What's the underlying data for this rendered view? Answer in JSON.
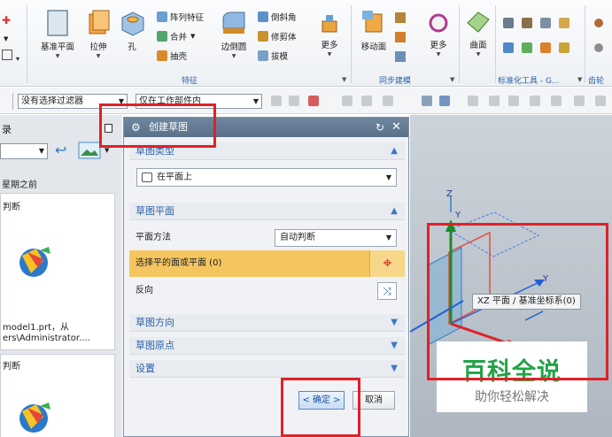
{
  "ribbon": {
    "feature_items": {
      "pattern": "阵列特征",
      "combine": "合并",
      "shell": "抽壳"
    },
    "buttons": {
      "datum_plane": "基准平面",
      "extrude": "拉伸",
      "hole": "孔",
      "edge_blend": "边倒圆",
      "more": "更多"
    },
    "direct_items": {
      "chamfer": "倒斜角",
      "trim_body": "修剪体",
      "draft": "拔模"
    },
    "sync": {
      "move_face": "移动面",
      "more": "更多"
    },
    "surface": "曲面",
    "groups": {
      "feature": "特征",
      "sync": "同步建模",
      "standard": "标准化工具 - G...",
      "gear": "齿轮"
    }
  },
  "filterbar": {
    "filter": "没有选择过滤器",
    "scope": "仅在工作部件内"
  },
  "navigator": {
    "title": "录",
    "group_before": "星期之前",
    "item_text1": "判断",
    "file_name": "model1.prt，从",
    "file_path": "ers\\Administrator....",
    "item_text2": "判断"
  },
  "dialog": {
    "title": "创建草图",
    "sketch_type_section": "草图类型",
    "sketch_type_value": "在平面上",
    "sketch_plane_section": "草图平面",
    "plane_method_label": "平面方法",
    "plane_method_value": "自动判断",
    "select_face_label": "选择平的面或平面 (0)",
    "reverse_label": "反向",
    "sketch_orientation_section": "草图方向",
    "sketch_origin_section": "草图原点",
    "settings_section": "设置",
    "ok_label": "< 确定 >",
    "cancel_label": "取消"
  },
  "viewport": {
    "axis_z": "Z",
    "axis_y": "Y",
    "axis_y2": "Y",
    "tooltip": "XZ 平面 / 基准坐标系(0)",
    "watermark_title": "百科全说",
    "watermark_sub": "助你轻松解决"
  },
  "colors": {
    "accent": "#2d62a8",
    "highlight_row": "#f5c660",
    "annotation_red": "#e02128",
    "watermark_green": "#22a345"
  }
}
